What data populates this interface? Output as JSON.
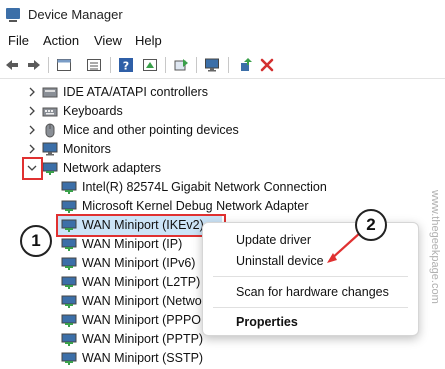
{
  "window": {
    "title": "Device Manager"
  },
  "menu": [
    "File",
    "Action",
    "View",
    "Help"
  ],
  "tree": {
    "categories": [
      {
        "label": "IDE ATA/ATAPI controllers",
        "icon": "ide-controller-icon"
      },
      {
        "label": "Keyboards",
        "icon": "keyboard-icon"
      },
      {
        "label": "Mice and other pointing devices",
        "icon": "mouse-icon"
      },
      {
        "label": "Monitors",
        "icon": "monitor-icon"
      },
      {
        "label": "Network adapters",
        "icon": "network-adapter-icon",
        "expanded": true
      }
    ],
    "network_adapters": [
      "Intel(R) 82574L Gigabit Network Connection",
      "Microsoft Kernel Debug Network Adapter",
      "WAN Miniport (IKEv2)",
      "WAN Miniport (IP)",
      "WAN Miniport (IPv6)",
      "WAN Miniport (L2TP)",
      "WAN Miniport (Netwo",
      "WAN Miniport (PPPOE",
      "WAN Miniport (PPTP)",
      "WAN Miniport (SSTP)"
    ],
    "selected": "WAN Miniport (IKEv2)"
  },
  "context_menu": {
    "items": [
      "Update driver",
      "Uninstall device",
      "Scan for hardware changes",
      "Properties"
    ]
  },
  "callouts": [
    "1",
    "2"
  ],
  "watermark": "www.thegeekpage.com",
  "colors": {
    "selection": "#cce4f7",
    "highlight": "#e03131",
    "delete_icon": "#d32f2f"
  }
}
